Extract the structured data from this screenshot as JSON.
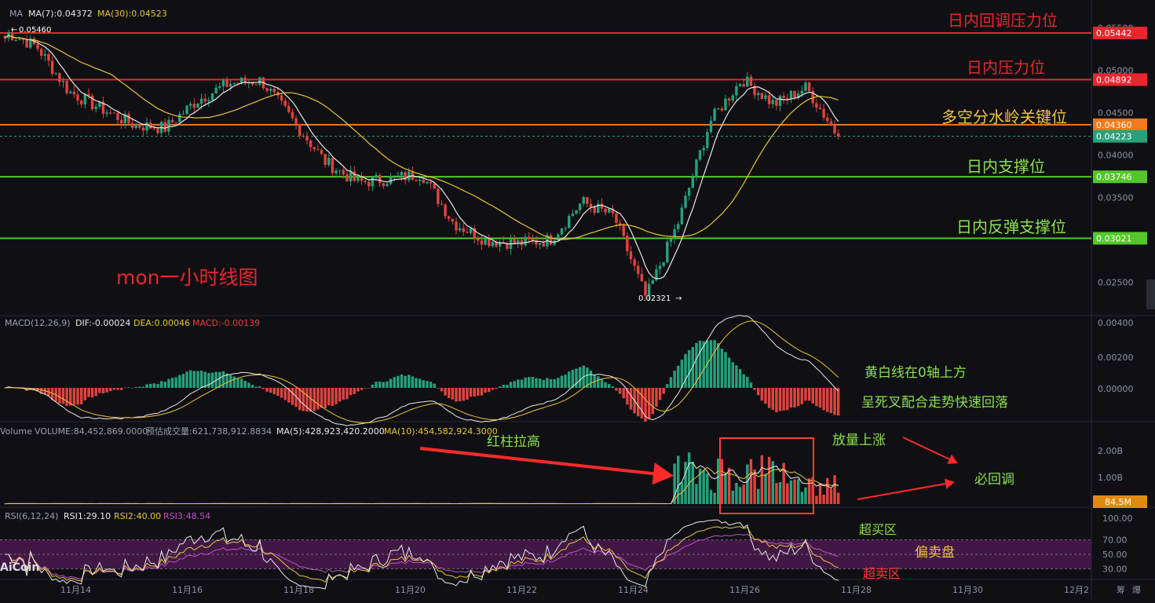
{
  "header": {
    "ma_label": "MA",
    "ma7": "MA(7):0.04372",
    "ma30": "MA(30):0.04523",
    "high_marker": "0.05460",
    "low_marker": "0.02321"
  },
  "price_axis": {
    "ticks": [
      "0.05500",
      "0.05000",
      "0.04500",
      "0.04000",
      "0.03500",
      "0.03000",
      "0.02500"
    ],
    "tick_values": [
      0.055,
      0.05,
      0.045,
      0.04,
      0.035,
      0.03,
      0.025
    ],
    "current": "0.04223"
  },
  "levels": [
    {
      "name": "日内回调压力位",
      "value": 0.05442,
      "label": "0.05442",
      "color": "#e8262e",
      "text_color": "#e8262e"
    },
    {
      "name": "日内压力位",
      "value": 0.04892,
      "label": "0.04892",
      "color": "#e8262e",
      "text_color": "#e8262e"
    },
    {
      "name": "多空分水岭关键位",
      "value": 0.0436,
      "label": "0.04360",
      "color": "#f07a1c",
      "text_color": "#f0c43a"
    },
    {
      "name": "日内支撑位",
      "value": 0.03746,
      "label": "0.03746",
      "color": "#54c72a",
      "text_color": "#8be04e"
    },
    {
      "name": "日内反弹支撑位",
      "value": 0.03021,
      "label": "0.03021",
      "color": "#54c72a",
      "text_color": "#8be04e"
    }
  ],
  "chart_title": "mon一小时线图",
  "macd": {
    "header_name": "MACD(12,26,9)",
    "dif": "DIF:-0.00024",
    "dea": "DEA:0.00046",
    "macd": "MACD:-0.00139",
    "ticks": [
      "0.00400",
      "0.00200",
      "0.00000"
    ],
    "note1": "黄白线在0轴上方",
    "note2": "呈死叉配合走势快速回落"
  },
  "volume": {
    "header_name": "Volume",
    "vol": "VOLUME:84,452,869.0000",
    "est": "预估成交量:621,738,912.8834",
    "ma5": "MA(5):428,923,420.2000",
    "ma10": "MA(10):454,582,924.3000",
    "ticks": [
      "2.00B",
      "1.00B"
    ],
    "current": "84.5M",
    "note_left": "红柱拉高",
    "note_up": "放量上涨",
    "note_back": "必回调"
  },
  "rsi": {
    "header_name": "RSI(6,12,24)",
    "rsi1": "RSI1:29.10",
    "rsi2": "RSI2:40.00",
    "rsi3": "RSI3:48.54",
    "ticks": [
      "100.00",
      "70.00",
      "50.00",
      "30.00"
    ],
    "note_ob": "超买区",
    "note_mid": "偏卖盘",
    "note_os": "超卖区"
  },
  "x_axis": {
    "labels": [
      "11月14",
      "11月16",
      "11月18",
      "11月20",
      "11月22",
      "11月24",
      "11月26",
      "11月28",
      "11月30",
      "12月2"
    ],
    "right_labels": [
      "筹",
      "爆"
    ]
  },
  "logo": "AiCoin",
  "colors": {
    "up": "#26a17b",
    "down": "#e0433f",
    "ma7": "#e8e8e8",
    "ma30": "#e8c43a",
    "rsi3": "#c050c8",
    "rsi_band": "#4a1a4e"
  },
  "chart_data": {
    "type": "candlestick",
    "title": "mon一小时线图",
    "x": [
      "11月14",
      "11月16",
      "11月18",
      "11月20",
      "11月22",
      "11月24",
      "11月26",
      "11月28"
    ],
    "close_path": [
      0.0546,
      0.0528,
      0.0475,
      0.0455,
      0.0436,
      0.0432,
      0.0465,
      0.0485,
      0.0488,
      0.044,
      0.0392,
      0.0368,
      0.0372,
      0.0378,
      0.032,
      0.03,
      0.0296,
      0.03,
      0.0345,
      0.0328,
      0.0232,
      0.032,
      0.044,
      0.049,
      0.046,
      0.048,
      0.0422
    ],
    "high": 0.0546,
    "low": 0.02321,
    "last": 0.04223,
    "horizontal_levels": [
      0.05442,
      0.04892,
      0.0436,
      0.03746,
      0.03021
    ],
    "ylim": [
      0.0232,
      0.0555
    ]
  }
}
